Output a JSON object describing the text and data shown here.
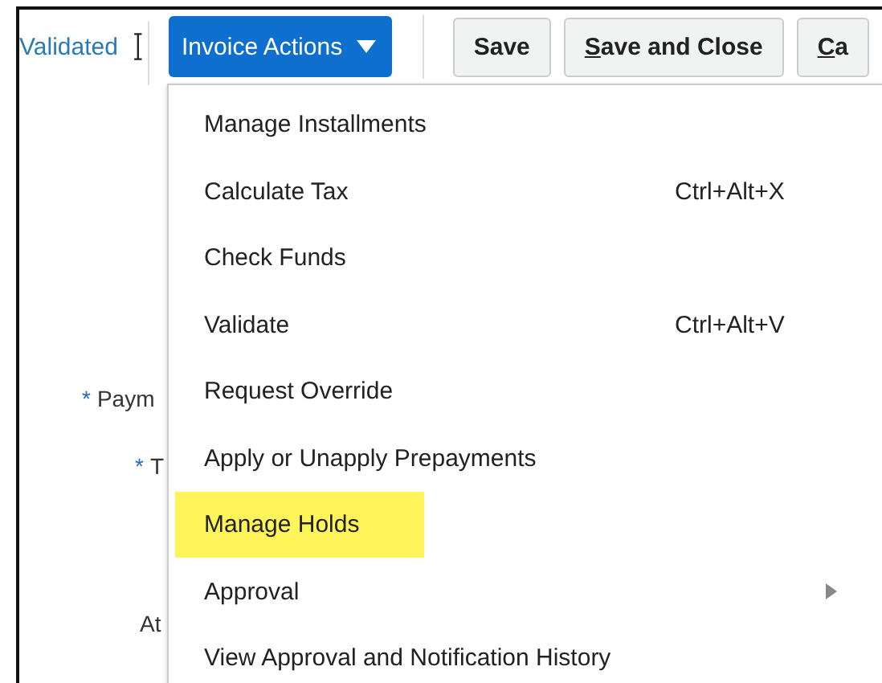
{
  "status": "Validated",
  "actions_button": {
    "label": "Invoice Actions"
  },
  "buttons": [
    {
      "label": "Save",
      "mnemonic": false
    },
    {
      "label": "Save and Close",
      "mnemonic": true
    },
    {
      "label": "Ca",
      "mnemonic": true
    }
  ],
  "form_labels": [
    {
      "mark": "*",
      "label": "Paym"
    },
    {
      "mark": "*",
      "label": "T"
    },
    {
      "label": "At"
    }
  ],
  "menu": [
    {
      "label": "Manage Installments",
      "selected": false,
      "kind": "item"
    },
    {
      "label": "Calculate Tax",
      "shortcut": "Ctrl+Alt+X",
      "selected": false,
      "kind": "item"
    },
    {
      "label": "Check Funds",
      "selected": false,
      "kind": "item"
    },
    {
      "label": "Validate",
      "shortcut": "Ctrl+Alt+V",
      "selected": false,
      "kind": "item"
    },
    {
      "label": "Request Override",
      "selected": false,
      "kind": "item"
    },
    {
      "label": "Apply or Unapply Prepayments",
      "selected": false,
      "kind": "item"
    },
    {
      "label": "Manage Holds",
      "selected": true,
      "kind": "item"
    },
    {
      "label": "Approval",
      "selected": false,
      "kind": "submenu"
    },
    {
      "label": "View Approval and Notification History",
      "selected": false,
      "kind": "item"
    }
  ]
}
